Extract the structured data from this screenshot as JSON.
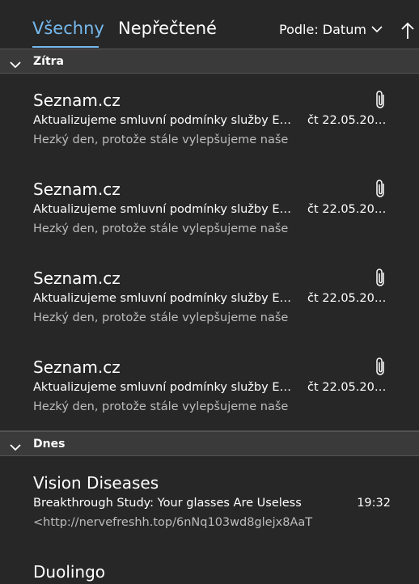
{
  "header": {
    "tabs": [
      {
        "label": "Všechny",
        "active": true
      },
      {
        "label": "Nepřečtené",
        "active": false
      }
    ],
    "sort_label": "Podle: Datum",
    "accent_color": "#76b9ed"
  },
  "groups": [
    {
      "label": "Zítra",
      "messages": [
        {
          "sender": "Seznam.cz",
          "subject": "Aktualizujeme smluvní podmínky služby Email...",
          "date": "čt 22.05.2025...",
          "preview": "Hezký den,  protože stále vylepšujeme naše",
          "has_attachment": true
        },
        {
          "sender": "Seznam.cz",
          "subject": "Aktualizujeme smluvní podmínky služby Email...",
          "date": "čt 22.05.2025...",
          "preview": "Hezký den,  protože stále vylepšujeme naše",
          "has_attachment": true
        },
        {
          "sender": "Seznam.cz",
          "subject": "Aktualizujeme smluvní podmínky služby Email...",
          "date": "čt 22.05.2025...",
          "preview": "Hezký den,  protože stále vylepšujeme naše",
          "has_attachment": true
        },
        {
          "sender": "Seznam.cz",
          "subject": "Aktualizujeme smluvní podmínky služby Email...",
          "date": "čt 22.05.2025...",
          "preview": "Hezký den,  protože stále vylepšujeme naše",
          "has_attachment": true
        }
      ]
    },
    {
      "label": "Dnes",
      "messages": [
        {
          "sender": "Vision Diseases",
          "subject": "Breakthrough Study: Your glasses Are Useless",
          "time": "19:32",
          "preview": "<http://nervefreshh.top/6nNq103wd8glejx8AaT",
          "has_attachment": false
        },
        {
          "sender": "Duolingo"
        }
      ]
    }
  ]
}
